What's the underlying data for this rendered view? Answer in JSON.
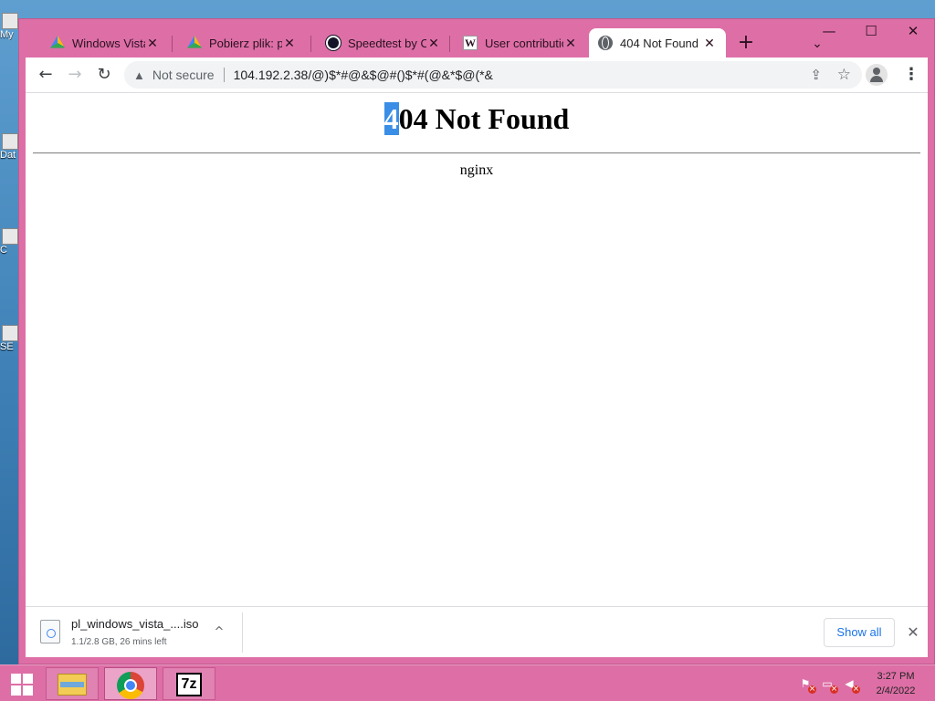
{
  "desktop": {
    "icons": [
      "My",
      "Dat",
      "C",
      "SE"
    ]
  },
  "tabs": [
    {
      "title": "Windows Vista -",
      "icon": "google-drive-icon"
    },
    {
      "title": "Pobierz plik: pl_",
      "icon": "google-drive-icon"
    },
    {
      "title": "Speedtest by Oo",
      "icon": "speedtest-icon"
    },
    {
      "title": "User contributio",
      "icon": "wikipedia-icon"
    },
    {
      "title": "404 Not Found",
      "icon": "globe-icon"
    }
  ],
  "tab_close_glyph": "✕",
  "new_tab_glyph": "+",
  "tab_search_glyph": "⌄",
  "window_controls": {
    "minimize": "—",
    "maximize": "☐",
    "close": "✕"
  },
  "toolbar": {
    "back_glyph": "←",
    "forward_glyph": "→",
    "reload_glyph": "↻",
    "security_label": "Not secure",
    "url": "104.192.2.38/@)$*#@&$@#()$*#(@&*$@(*&",
    "menu_glyph": "⋮"
  },
  "page": {
    "heading_first_char": "4",
    "heading_rest": "04 Not Found",
    "server": "nginx"
  },
  "download": {
    "filename": "pl_windows_vista_....iso",
    "status": "1.1/2.8 GB, 26 mins left",
    "show_all_label": "Show all",
    "close_glyph": "✕",
    "chevron_glyph": "^"
  },
  "taskbar": {
    "apps": [
      "file-explorer",
      "google-chrome",
      "7-zip"
    ],
    "sevenzip_label": "7z",
    "clock_time": "3:27 PM",
    "clock_date": "2/4/2022"
  },
  "colors": {
    "window_frame": "#dd6fa6",
    "selection": "#3a8ee6",
    "link_blue": "#1a73e8"
  }
}
